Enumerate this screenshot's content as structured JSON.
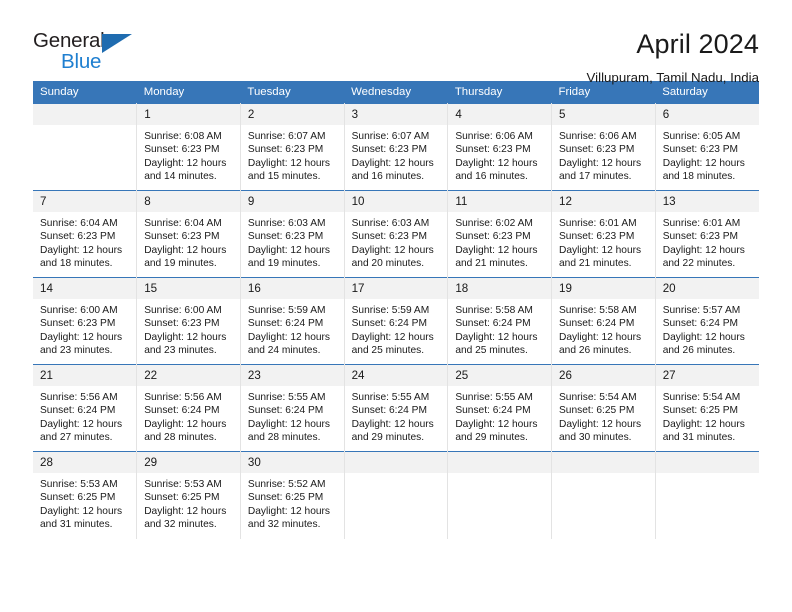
{
  "brand": {
    "line1": "General",
    "line2": "Blue",
    "triangle_color": "#1f6cb0",
    "blue_text_color": "#1f7fd0"
  },
  "header": {
    "title": "April 2024",
    "location": "Villupuram, Tamil Nadu, India"
  },
  "calendar": {
    "header_color": "#3776b8",
    "daynum_band_color": "#f2f2f2",
    "weekdays": [
      "Sunday",
      "Monday",
      "Tuesday",
      "Wednesday",
      "Thursday",
      "Friday",
      "Saturday"
    ],
    "weeks": [
      [
        {
          "day": "",
          "sunrise": "",
          "sunset": "",
          "daylight1": "",
          "daylight2": ""
        },
        {
          "day": "1",
          "sunrise": "Sunrise: 6:08 AM",
          "sunset": "Sunset: 6:23 PM",
          "daylight1": "Daylight: 12 hours",
          "daylight2": "and 14 minutes."
        },
        {
          "day": "2",
          "sunrise": "Sunrise: 6:07 AM",
          "sunset": "Sunset: 6:23 PM",
          "daylight1": "Daylight: 12 hours",
          "daylight2": "and 15 minutes."
        },
        {
          "day": "3",
          "sunrise": "Sunrise: 6:07 AM",
          "sunset": "Sunset: 6:23 PM",
          "daylight1": "Daylight: 12 hours",
          "daylight2": "and 16 minutes."
        },
        {
          "day": "4",
          "sunrise": "Sunrise: 6:06 AM",
          "sunset": "Sunset: 6:23 PM",
          "daylight1": "Daylight: 12 hours",
          "daylight2": "and 16 minutes."
        },
        {
          "day": "5",
          "sunrise": "Sunrise: 6:06 AM",
          "sunset": "Sunset: 6:23 PM",
          "daylight1": "Daylight: 12 hours",
          "daylight2": "and 17 minutes."
        },
        {
          "day": "6",
          "sunrise": "Sunrise: 6:05 AM",
          "sunset": "Sunset: 6:23 PM",
          "daylight1": "Daylight: 12 hours",
          "daylight2": "and 18 minutes."
        }
      ],
      [
        {
          "day": "7",
          "sunrise": "Sunrise: 6:04 AM",
          "sunset": "Sunset: 6:23 PM",
          "daylight1": "Daylight: 12 hours",
          "daylight2": "and 18 minutes."
        },
        {
          "day": "8",
          "sunrise": "Sunrise: 6:04 AM",
          "sunset": "Sunset: 6:23 PM",
          "daylight1": "Daylight: 12 hours",
          "daylight2": "and 19 minutes."
        },
        {
          "day": "9",
          "sunrise": "Sunrise: 6:03 AM",
          "sunset": "Sunset: 6:23 PM",
          "daylight1": "Daylight: 12 hours",
          "daylight2": "and 19 minutes."
        },
        {
          "day": "10",
          "sunrise": "Sunrise: 6:03 AM",
          "sunset": "Sunset: 6:23 PM",
          "daylight1": "Daylight: 12 hours",
          "daylight2": "and 20 minutes."
        },
        {
          "day": "11",
          "sunrise": "Sunrise: 6:02 AM",
          "sunset": "Sunset: 6:23 PM",
          "daylight1": "Daylight: 12 hours",
          "daylight2": "and 21 minutes."
        },
        {
          "day": "12",
          "sunrise": "Sunrise: 6:01 AM",
          "sunset": "Sunset: 6:23 PM",
          "daylight1": "Daylight: 12 hours",
          "daylight2": "and 21 minutes."
        },
        {
          "day": "13",
          "sunrise": "Sunrise: 6:01 AM",
          "sunset": "Sunset: 6:23 PM",
          "daylight1": "Daylight: 12 hours",
          "daylight2": "and 22 minutes."
        }
      ],
      [
        {
          "day": "14",
          "sunrise": "Sunrise: 6:00 AM",
          "sunset": "Sunset: 6:23 PM",
          "daylight1": "Daylight: 12 hours",
          "daylight2": "and 23 minutes."
        },
        {
          "day": "15",
          "sunrise": "Sunrise: 6:00 AM",
          "sunset": "Sunset: 6:23 PM",
          "daylight1": "Daylight: 12 hours",
          "daylight2": "and 23 minutes."
        },
        {
          "day": "16",
          "sunrise": "Sunrise: 5:59 AM",
          "sunset": "Sunset: 6:24 PM",
          "daylight1": "Daylight: 12 hours",
          "daylight2": "and 24 minutes."
        },
        {
          "day": "17",
          "sunrise": "Sunrise: 5:59 AM",
          "sunset": "Sunset: 6:24 PM",
          "daylight1": "Daylight: 12 hours",
          "daylight2": "and 25 minutes."
        },
        {
          "day": "18",
          "sunrise": "Sunrise: 5:58 AM",
          "sunset": "Sunset: 6:24 PM",
          "daylight1": "Daylight: 12 hours",
          "daylight2": "and 25 minutes."
        },
        {
          "day": "19",
          "sunrise": "Sunrise: 5:58 AM",
          "sunset": "Sunset: 6:24 PM",
          "daylight1": "Daylight: 12 hours",
          "daylight2": "and 26 minutes."
        },
        {
          "day": "20",
          "sunrise": "Sunrise: 5:57 AM",
          "sunset": "Sunset: 6:24 PM",
          "daylight1": "Daylight: 12 hours",
          "daylight2": "and 26 minutes."
        }
      ],
      [
        {
          "day": "21",
          "sunrise": "Sunrise: 5:56 AM",
          "sunset": "Sunset: 6:24 PM",
          "daylight1": "Daylight: 12 hours",
          "daylight2": "and 27 minutes."
        },
        {
          "day": "22",
          "sunrise": "Sunrise: 5:56 AM",
          "sunset": "Sunset: 6:24 PM",
          "daylight1": "Daylight: 12 hours",
          "daylight2": "and 28 minutes."
        },
        {
          "day": "23",
          "sunrise": "Sunrise: 5:55 AM",
          "sunset": "Sunset: 6:24 PM",
          "daylight1": "Daylight: 12 hours",
          "daylight2": "and 28 minutes."
        },
        {
          "day": "24",
          "sunrise": "Sunrise: 5:55 AM",
          "sunset": "Sunset: 6:24 PM",
          "daylight1": "Daylight: 12 hours",
          "daylight2": "and 29 minutes."
        },
        {
          "day": "25",
          "sunrise": "Sunrise: 5:55 AM",
          "sunset": "Sunset: 6:24 PM",
          "daylight1": "Daylight: 12 hours",
          "daylight2": "and 29 minutes."
        },
        {
          "day": "26",
          "sunrise": "Sunrise: 5:54 AM",
          "sunset": "Sunset: 6:25 PM",
          "daylight1": "Daylight: 12 hours",
          "daylight2": "and 30 minutes."
        },
        {
          "day": "27",
          "sunrise": "Sunrise: 5:54 AM",
          "sunset": "Sunset: 6:25 PM",
          "daylight1": "Daylight: 12 hours",
          "daylight2": "and 31 minutes."
        }
      ],
      [
        {
          "day": "28",
          "sunrise": "Sunrise: 5:53 AM",
          "sunset": "Sunset: 6:25 PM",
          "daylight1": "Daylight: 12 hours",
          "daylight2": "and 31 minutes."
        },
        {
          "day": "29",
          "sunrise": "Sunrise: 5:53 AM",
          "sunset": "Sunset: 6:25 PM",
          "daylight1": "Daylight: 12 hours",
          "daylight2": "and 32 minutes."
        },
        {
          "day": "30",
          "sunrise": "Sunrise: 5:52 AM",
          "sunset": "Sunset: 6:25 PM",
          "daylight1": "Daylight: 12 hours",
          "daylight2": "and 32 minutes."
        },
        {
          "day": "",
          "sunrise": "",
          "sunset": "",
          "daylight1": "",
          "daylight2": ""
        },
        {
          "day": "",
          "sunrise": "",
          "sunset": "",
          "daylight1": "",
          "daylight2": ""
        },
        {
          "day": "",
          "sunrise": "",
          "sunset": "",
          "daylight1": "",
          "daylight2": ""
        },
        {
          "day": "",
          "sunrise": "",
          "sunset": "",
          "daylight1": "",
          "daylight2": ""
        }
      ]
    ]
  }
}
